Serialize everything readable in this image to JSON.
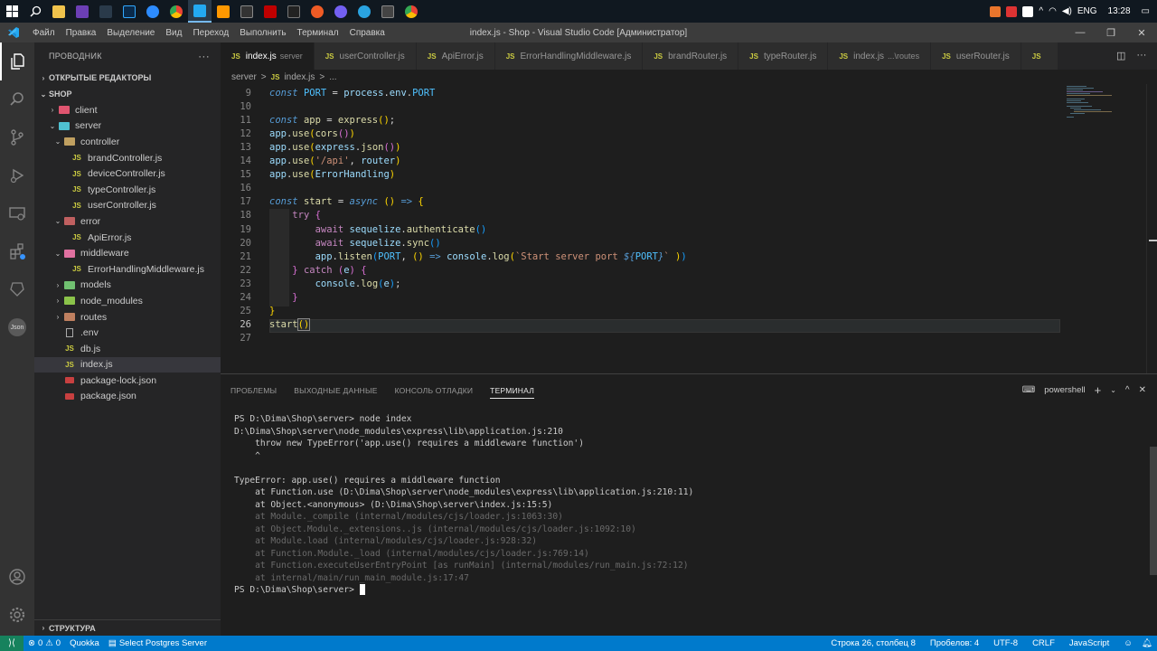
{
  "taskbar": {
    "tray": {
      "lang": "ENG",
      "time": "13:28"
    }
  },
  "titlebar": {
    "menu": [
      "Файл",
      "Правка",
      "Выделение",
      "Вид",
      "Переход",
      "Выполнить",
      "Терминал",
      "Справка"
    ],
    "title": "index.js - Shop - Visual Studio Code [Администратор]"
  },
  "sidebar": {
    "title": "ПРОВОДНИК",
    "more": "···",
    "open_editors": "ОТКРЫТЫЕ РЕДАКТОРЫ",
    "workspace": "SHOP",
    "tree": [
      {
        "label": "client",
        "depth": 1,
        "kind": "folder",
        "open": false
      },
      {
        "label": "server",
        "depth": 1,
        "kind": "folder",
        "open": true
      },
      {
        "label": "controller",
        "depth": 2,
        "kind": "folder",
        "open": true
      },
      {
        "label": "brandController.js",
        "depth": 3,
        "kind": "js"
      },
      {
        "label": "deviceController.js",
        "depth": 3,
        "kind": "js"
      },
      {
        "label": "typeController.js",
        "depth": 3,
        "kind": "js"
      },
      {
        "label": "userController.js",
        "depth": 3,
        "kind": "js"
      },
      {
        "label": "error",
        "depth": 2,
        "kind": "folder",
        "open": true
      },
      {
        "label": "ApiError.js",
        "depth": 3,
        "kind": "js"
      },
      {
        "label": "middleware",
        "depth": 2,
        "kind": "folder",
        "open": true
      },
      {
        "label": "ErrorHandlingMiddleware.js",
        "depth": 3,
        "kind": "js"
      },
      {
        "label": "models",
        "depth": 2,
        "kind": "folder",
        "open": false
      },
      {
        "label": "node_modules",
        "depth": 2,
        "kind": "folder",
        "open": false
      },
      {
        "label": "routes",
        "depth": 2,
        "kind": "folder",
        "open": false
      },
      {
        "label": ".env",
        "depth": 2,
        "kind": "env"
      },
      {
        "label": "db.js",
        "depth": 2,
        "kind": "js"
      },
      {
        "label": "index.js",
        "depth": 2,
        "kind": "js",
        "selected": true
      },
      {
        "label": "package-lock.json",
        "depth": 2,
        "kind": "json"
      },
      {
        "label": "package.json",
        "depth": 2,
        "kind": "json"
      }
    ],
    "outline": "СТРУКТУРА"
  },
  "tabs": [
    {
      "label": "index.js",
      "desc": "server",
      "active": true
    },
    {
      "label": "userController.js"
    },
    {
      "label": "ApiError.js"
    },
    {
      "label": "ErrorHandlingMiddleware.js"
    },
    {
      "label": "brandRouter.js"
    },
    {
      "label": "typeRouter.js"
    },
    {
      "label": "index.js",
      "desc": "...\\routes"
    },
    {
      "label": "userRouter.js"
    },
    {
      "label": "JS"
    }
  ],
  "breadcrumb": [
    "server",
    ">",
    "JS",
    "index.js",
    ">",
    "..."
  ],
  "editor": {
    "line_numbers": [
      "9",
      "10",
      "11",
      "12",
      "13",
      "14",
      "15",
      "16",
      "17",
      "18",
      "19",
      "20",
      "21",
      "22",
      "23",
      "24",
      "25",
      "26",
      "27"
    ],
    "current_line": "26"
  },
  "panel": {
    "tabs": [
      "ПРОБЛЕМЫ",
      "ВЫХОДНЫЕ ДАННЫЕ",
      "КОНСОЛЬ ОТЛАДКИ",
      "ТЕРМИНАЛ"
    ],
    "active_tab": "ТЕРМИНАЛ",
    "shell": "powershell",
    "terminal": [
      {
        "text": "PS D:\\Dima\\Shop\\server> node index",
        "dim": false
      },
      {
        "text": "D:\\Dima\\Shop\\server\\node_modules\\express\\lib\\application.js:210",
        "dim": false
      },
      {
        "text": "    throw new TypeError('app.use() requires a middleware function')",
        "dim": false
      },
      {
        "text": "    ^",
        "dim": false
      },
      {
        "text": "",
        "dim": false
      },
      {
        "text": "TypeError: app.use() requires a middleware function",
        "dim": false
      },
      {
        "text": "    at Function.use (D:\\Dima\\Shop\\server\\node_modules\\express\\lib\\application.js:210:11)",
        "dim": false
      },
      {
        "text": "    at Object.<anonymous> (D:\\Dima\\Shop\\server\\index.js:15:5)",
        "dim": false
      },
      {
        "text": "    at Module._compile (internal/modules/cjs/loader.js:1063:30)",
        "dim": true
      },
      {
        "text": "    at Object.Module._extensions..js (internal/modules/cjs/loader.js:1092:10)",
        "dim": true
      },
      {
        "text": "    at Module.load (internal/modules/cjs/loader.js:928:32)",
        "dim": true
      },
      {
        "text": "    at Function.Module._load (internal/modules/cjs/loader.js:769:14)",
        "dim": true
      },
      {
        "text": "    at Function.executeUserEntryPoint [as runMain] (internal/modules/run_main.js:72:12)",
        "dim": true
      },
      {
        "text": "    at internal/main/run_main_module.js:17:47",
        "dim": true
      }
    ],
    "prompt": "PS D:\\Dima\\Shop\\server> "
  },
  "statusbar": {
    "errors": "0",
    "warnings": "0",
    "quokka": "Quokka",
    "db": "Select Postgres Server",
    "position": "Строка 26, столбец 8",
    "spaces": "Пробелов: 4",
    "encoding": "UTF-8",
    "eol": "CRLF",
    "language": "JavaScript"
  },
  "colors": {
    "accent": "#007acc",
    "activity_bar": "#333333",
    "sidebar": "#252526",
    "editor": "#1e1e1e"
  }
}
